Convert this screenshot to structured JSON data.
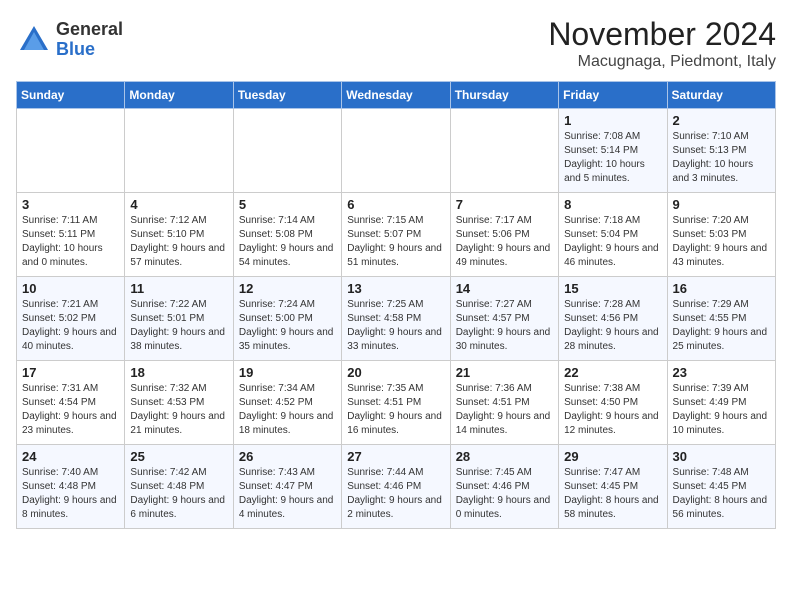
{
  "logo": {
    "general": "General",
    "blue": "Blue"
  },
  "title": "November 2024",
  "location": "Macugnaga, Piedmont, Italy",
  "days_of_week": [
    "Sunday",
    "Monday",
    "Tuesday",
    "Wednesday",
    "Thursday",
    "Friday",
    "Saturday"
  ],
  "weeks": [
    [
      {
        "day": "",
        "info": ""
      },
      {
        "day": "",
        "info": ""
      },
      {
        "day": "",
        "info": ""
      },
      {
        "day": "",
        "info": ""
      },
      {
        "day": "",
        "info": ""
      },
      {
        "day": "1",
        "info": "Sunrise: 7:08 AM\nSunset: 5:14 PM\nDaylight: 10 hours and 5 minutes."
      },
      {
        "day": "2",
        "info": "Sunrise: 7:10 AM\nSunset: 5:13 PM\nDaylight: 10 hours and 3 minutes."
      }
    ],
    [
      {
        "day": "3",
        "info": "Sunrise: 7:11 AM\nSunset: 5:11 PM\nDaylight: 10 hours and 0 minutes."
      },
      {
        "day": "4",
        "info": "Sunrise: 7:12 AM\nSunset: 5:10 PM\nDaylight: 9 hours and 57 minutes."
      },
      {
        "day": "5",
        "info": "Sunrise: 7:14 AM\nSunset: 5:08 PM\nDaylight: 9 hours and 54 minutes."
      },
      {
        "day": "6",
        "info": "Sunrise: 7:15 AM\nSunset: 5:07 PM\nDaylight: 9 hours and 51 minutes."
      },
      {
        "day": "7",
        "info": "Sunrise: 7:17 AM\nSunset: 5:06 PM\nDaylight: 9 hours and 49 minutes."
      },
      {
        "day": "8",
        "info": "Sunrise: 7:18 AM\nSunset: 5:04 PM\nDaylight: 9 hours and 46 minutes."
      },
      {
        "day": "9",
        "info": "Sunrise: 7:20 AM\nSunset: 5:03 PM\nDaylight: 9 hours and 43 minutes."
      }
    ],
    [
      {
        "day": "10",
        "info": "Sunrise: 7:21 AM\nSunset: 5:02 PM\nDaylight: 9 hours and 40 minutes."
      },
      {
        "day": "11",
        "info": "Sunrise: 7:22 AM\nSunset: 5:01 PM\nDaylight: 9 hours and 38 minutes."
      },
      {
        "day": "12",
        "info": "Sunrise: 7:24 AM\nSunset: 5:00 PM\nDaylight: 9 hours and 35 minutes."
      },
      {
        "day": "13",
        "info": "Sunrise: 7:25 AM\nSunset: 4:58 PM\nDaylight: 9 hours and 33 minutes."
      },
      {
        "day": "14",
        "info": "Sunrise: 7:27 AM\nSunset: 4:57 PM\nDaylight: 9 hours and 30 minutes."
      },
      {
        "day": "15",
        "info": "Sunrise: 7:28 AM\nSunset: 4:56 PM\nDaylight: 9 hours and 28 minutes."
      },
      {
        "day": "16",
        "info": "Sunrise: 7:29 AM\nSunset: 4:55 PM\nDaylight: 9 hours and 25 minutes."
      }
    ],
    [
      {
        "day": "17",
        "info": "Sunrise: 7:31 AM\nSunset: 4:54 PM\nDaylight: 9 hours and 23 minutes."
      },
      {
        "day": "18",
        "info": "Sunrise: 7:32 AM\nSunset: 4:53 PM\nDaylight: 9 hours and 21 minutes."
      },
      {
        "day": "19",
        "info": "Sunrise: 7:34 AM\nSunset: 4:52 PM\nDaylight: 9 hours and 18 minutes."
      },
      {
        "day": "20",
        "info": "Sunrise: 7:35 AM\nSunset: 4:51 PM\nDaylight: 9 hours and 16 minutes."
      },
      {
        "day": "21",
        "info": "Sunrise: 7:36 AM\nSunset: 4:51 PM\nDaylight: 9 hours and 14 minutes."
      },
      {
        "day": "22",
        "info": "Sunrise: 7:38 AM\nSunset: 4:50 PM\nDaylight: 9 hours and 12 minutes."
      },
      {
        "day": "23",
        "info": "Sunrise: 7:39 AM\nSunset: 4:49 PM\nDaylight: 9 hours and 10 minutes."
      }
    ],
    [
      {
        "day": "24",
        "info": "Sunrise: 7:40 AM\nSunset: 4:48 PM\nDaylight: 9 hours and 8 minutes."
      },
      {
        "day": "25",
        "info": "Sunrise: 7:42 AM\nSunset: 4:48 PM\nDaylight: 9 hours and 6 minutes."
      },
      {
        "day": "26",
        "info": "Sunrise: 7:43 AM\nSunset: 4:47 PM\nDaylight: 9 hours and 4 minutes."
      },
      {
        "day": "27",
        "info": "Sunrise: 7:44 AM\nSunset: 4:46 PM\nDaylight: 9 hours and 2 minutes."
      },
      {
        "day": "28",
        "info": "Sunrise: 7:45 AM\nSunset: 4:46 PM\nDaylight: 9 hours and 0 minutes."
      },
      {
        "day": "29",
        "info": "Sunrise: 7:47 AM\nSunset: 4:45 PM\nDaylight: 8 hours and 58 minutes."
      },
      {
        "day": "30",
        "info": "Sunrise: 7:48 AM\nSunset: 4:45 PM\nDaylight: 8 hours and 56 minutes."
      }
    ]
  ]
}
